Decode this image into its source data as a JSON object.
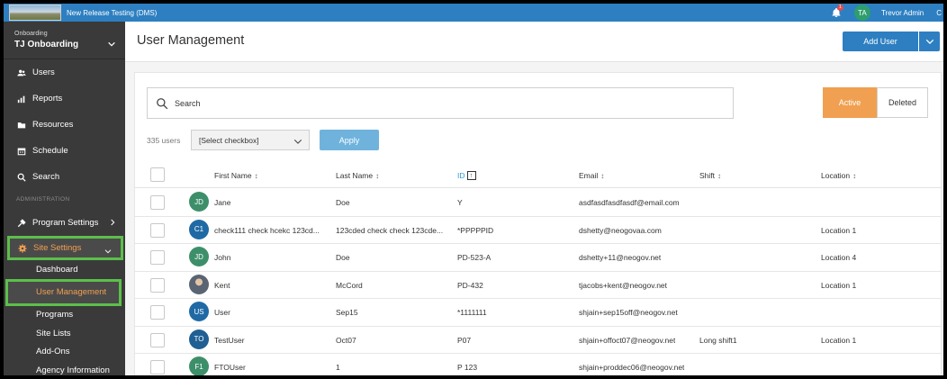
{
  "topbar": {
    "app_title": "New Release Testing (DMS)",
    "notification_count": "1",
    "user_initials": "TA",
    "user_name": "Trevor Admin",
    "cut_text": "C"
  },
  "sidebar": {
    "org_label": "Onboarding",
    "org_name": "TJ Onboarding",
    "items": [
      {
        "label": "Users",
        "icon": "users-icon"
      },
      {
        "label": "Reports",
        "icon": "bar-chart-icon"
      },
      {
        "label": "Resources",
        "icon": "folder-icon"
      },
      {
        "label": "Schedule",
        "icon": "calendar-icon"
      },
      {
        "label": "Search",
        "icon": "search-icon"
      }
    ],
    "admin_header": "ADMINISTRATION",
    "program_settings": "Program Settings",
    "site_settings": "Site Settings",
    "sub_items": [
      "Dashboard",
      "User Management",
      "Programs",
      "Site Lists",
      "Add-Ons",
      "Agency Information"
    ]
  },
  "main": {
    "title": "User Management",
    "add_user": "Add User",
    "search_placeholder": "Search",
    "tab_active": "Active",
    "tab_deleted": "Deleted",
    "count": "335 users",
    "bulk_select": "[Select checkbox]",
    "apply": "Apply",
    "columns": {
      "first_name": "First Name",
      "last_name": "Last Name",
      "id": "ID",
      "email": "Email",
      "shift": "Shift",
      "location": "Location"
    },
    "rows": [
      {
        "initials": "JD",
        "avatar_color": "#3d8f6a",
        "first": "Jane",
        "last": "Doe",
        "id": "Y",
        "email": "asdfasdfasdfasdf@email.com",
        "shift": "",
        "location": ""
      },
      {
        "initials": "C1",
        "avatar_color": "#1f6aa5",
        "first": "check111 check hcekc 123cd...",
        "last": "123cded check check 123cde...",
        "id": "*PPPPPID",
        "email": "dshetty@neogovaa.com",
        "shift": "",
        "location": "Location 1"
      },
      {
        "initials": "JD",
        "avatar_color": "#3d8f6a",
        "first": "John",
        "last": "Doe",
        "id": "PD-523-A",
        "email": "dshetty+11@neogov.net",
        "shift": "",
        "location": "Location 4"
      },
      {
        "initials": "",
        "avatar_color": "photo",
        "first": "Kent",
        "last": "McCord",
        "id": "PD-432",
        "email": "tjacobs+kent@neogov.net",
        "shift": "",
        "location": "Location 1"
      },
      {
        "initials": "US",
        "avatar_color": "#1f6aa5",
        "first": "User",
        "last": "Sep15",
        "id": "*1111111",
        "email": "shjain+sep15off@neogov.net",
        "shift": "",
        "location": ""
      },
      {
        "initials": "TO",
        "avatar_color": "#1f5f94",
        "first": "TestUser",
        "last": "Oct07",
        "id": "P07",
        "email": "shjain+offoct07@neogov.net",
        "shift": "Long shift1",
        "location": "Location 1"
      },
      {
        "initials": "F1",
        "avatar_color": "#3d8f6a",
        "first": "FTOUser",
        "last": "1",
        "id": "P 123",
        "email": "shjain+proddec06@neogov.net",
        "shift": "",
        "location": ""
      }
    ]
  },
  "colors": {
    "brand": "#2d7fc1",
    "accent": "#f0a050",
    "highlight": "#5cbf4a",
    "sidebar": "#3a3a3a"
  }
}
